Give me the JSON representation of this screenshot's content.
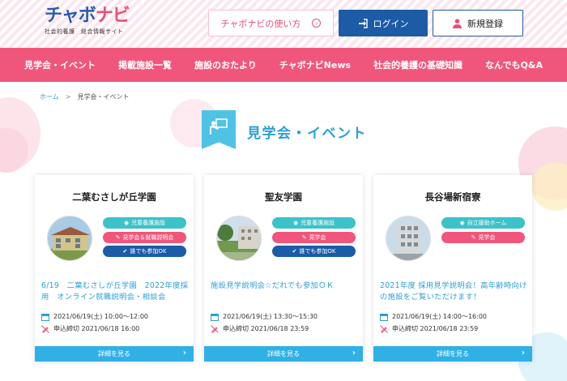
{
  "header": {
    "logo_main_part1": "チャボ",
    "logo_main_part2": "ナビ",
    "logo_sub": "社会的養護　総合情報サイト",
    "howto_label": "チャボナビの使い方",
    "login_label": "ログイン",
    "signup_label": "新規登録"
  },
  "nav": {
    "items": [
      {
        "label": "見学会・イベント"
      },
      {
        "label": "掲載施設一覧"
      },
      {
        "label": "施設のおたより"
      },
      {
        "label": "チャボナビNews"
      },
      {
        "label": "社会的養護の基礎知識"
      },
      {
        "label": "なんでもQ&A"
      }
    ]
  },
  "breadcrumb": {
    "home": "ホーム",
    "separator": ">",
    "current": "見学会・イベント"
  },
  "page_title": "見学会・イベント",
  "cards": [
    {
      "facility": "二葉むさしが丘学園",
      "tags": [
        "児童養護施設",
        "見学会＆就職説明会",
        "誰でも参加OK"
      ],
      "event_title": "6/19　二葉むさしが丘学園　2022年度採用　オンライン就職説明会・相談会",
      "date": "2021/06/19(土) 10:00～12:00",
      "deadline": "申込締切 2021/06/18 16:00",
      "button": "詳細を見る"
    },
    {
      "facility": "聖友学園",
      "tags": [
        "児童養護施設",
        "見学会",
        "誰でも参加OK"
      ],
      "event_title": "施設見学説明会☆だれでも参加ＯＫ",
      "date": "2021/06/19(土) 13:30～15:30",
      "deadline": "申込締切 2021/06/18 23:59",
      "button": "詳細を見る"
    },
    {
      "facility": "長谷場新宿寮",
      "tags": [
        "自立援助ホーム",
        "見学会"
      ],
      "event_title": "2021年度 採用見学説明会！高年齢時向けの施設をご覧いただけます！",
      "date": "2021/06/19(土) 14:00～16:00",
      "deadline": "申込締切 2021/06/18 23:59",
      "button": "詳細を見る"
    }
  ],
  "colors": {
    "nav_pink": "#f0567b",
    "login_blue": "#1c5ba6",
    "accent_cyan": "#2fb1e6",
    "tag_teal": "#3cc2c9"
  }
}
